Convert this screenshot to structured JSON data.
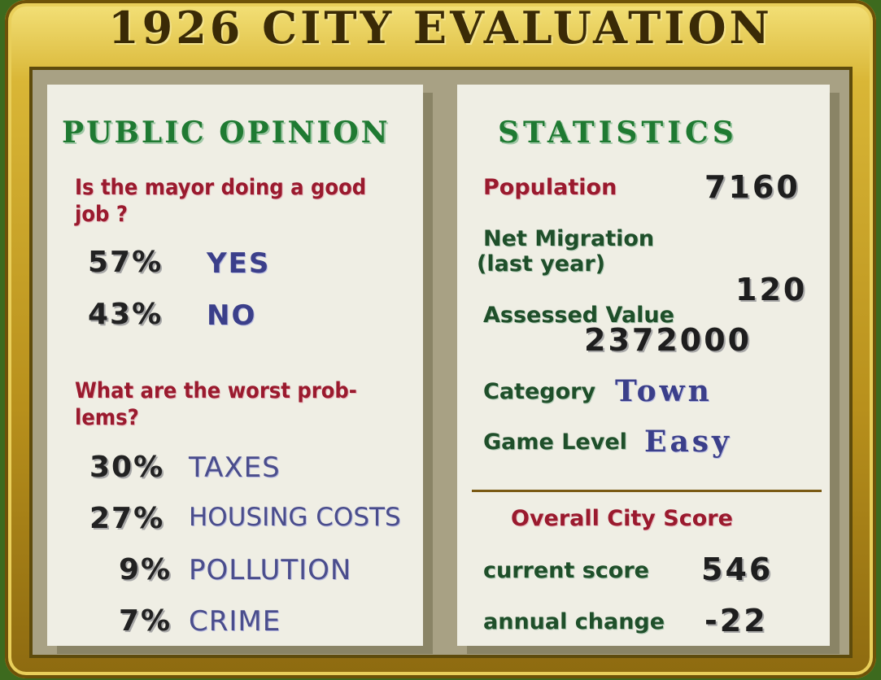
{
  "title": "1926 CITY EVALUATION",
  "public_opinion": {
    "heading": "PUBLIC OPINION",
    "question1_line1": "Is the mayor doing a good",
    "question1_line2": "job ?",
    "yes_pct": "57%",
    "yes_label": "YES",
    "no_pct": "43%",
    "no_label": "NO",
    "question2_line1": "What are the worst prob-",
    "question2_line2": "lems?",
    "problems": [
      {
        "pct": "30%",
        "label": "TAXES"
      },
      {
        "pct": "27%",
        "label": "HOUSING COSTS"
      },
      {
        "pct": "9%",
        "label": "POLLUTION"
      },
      {
        "pct": "7%",
        "label": "CRIME"
      }
    ]
  },
  "statistics": {
    "heading": "STATISTICS",
    "population_label": "Population",
    "population_value": "7160",
    "migration_label_line1": "Net Migration",
    "migration_label_line2": "(last year)",
    "migration_value": "120",
    "assessed_label": "Assessed Value",
    "assessed_value": "2372000",
    "category_label": "Category",
    "category_value": "Town",
    "level_label": "Game Level",
    "level_value": "Easy",
    "score_heading": "Overall City Score",
    "current_label": "current score",
    "current_value": "546",
    "annual_label": "annual change",
    "annual_value": "-22"
  },
  "colors": {
    "frame_gold": "#d9b636",
    "panel": "#efeee4",
    "heading_green": "#1f7a32",
    "question_red": "#9a1a2e",
    "answer_blue": "#3b3f8a"
  }
}
